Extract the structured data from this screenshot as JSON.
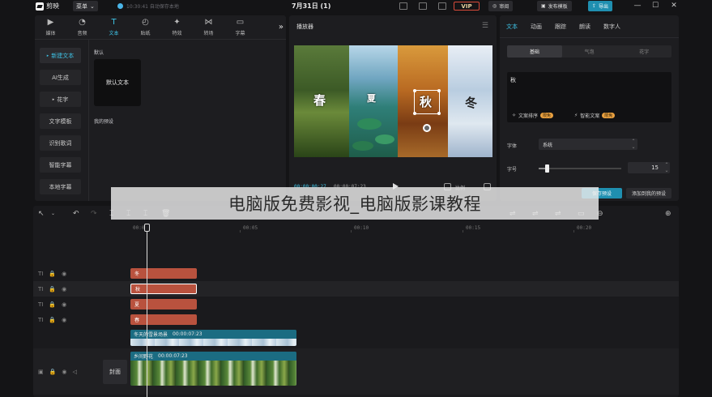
{
  "titlebar": {
    "app_name": "剪映",
    "menu_label": "菜单",
    "autosave": "10:30:41 自动保存本地",
    "project_title": "7月31日 (1)",
    "vip_label": "VIP",
    "review_label": "审阅",
    "publish_template_label": "发布模板",
    "export_label": "导出"
  },
  "tools": {
    "tabs": [
      {
        "label": "媒体",
        "icon": "media-icon"
      },
      {
        "label": "音频",
        "icon": "audio-icon"
      },
      {
        "label": "文本",
        "icon": "text-icon"
      },
      {
        "label": "贴纸",
        "icon": "sticker-icon"
      },
      {
        "label": "特效",
        "icon": "effects-icon"
      },
      {
        "label": "转场",
        "icon": "transition-icon"
      },
      {
        "label": "字幕",
        "icon": "caption-icon"
      }
    ],
    "active_tab": "文本"
  },
  "text_panel": {
    "side_items": [
      "新建文本",
      "AI生成",
      "花字",
      "文字模板",
      "识别歌词",
      "智能字幕",
      "本地字幕"
    ],
    "default_section": "默认",
    "default_card": "默认文本",
    "presets_section": "我的预设"
  },
  "player": {
    "title": "播放器",
    "current_time": "00:00:00:27",
    "duration": "00:00:07:23",
    "ratio_label": "比例",
    "overlay_chars": [
      "春",
      "夏",
      "秋",
      "冬"
    ]
  },
  "inspector": {
    "tabs": [
      "文本",
      "动画",
      "跟踪",
      "朗读",
      "数字人"
    ],
    "active_tab": "文本",
    "sub_tabs": [
      "基础",
      "气泡",
      "花字"
    ],
    "active_sub_tab": "基础",
    "text_value": "秋",
    "feature_1": "文案排序",
    "feature_2": "智能文案",
    "feature_badge": "限免",
    "font_label": "字体",
    "font_value": "系统",
    "size_label": "字号",
    "size_value": "15",
    "size_fraction": 0.1,
    "save_preset_label": "保存预设",
    "add_preset_label": "添加到我的预设"
  },
  "timeline": {
    "ruler_labels": [
      "00:00",
      "00:05",
      "00:10",
      "00:15",
      "00:20"
    ],
    "text_clips": [
      "冬",
      "秋",
      "夏",
      "春"
    ],
    "video_track_1": {
      "name": "冬天的雪景场景",
      "duration": "00:00:07:23"
    },
    "video_track_2": {
      "name": "乡间野花",
      "duration": "00:00:07:23"
    },
    "cover_label": "封面"
  },
  "watermark": "电脑版免费影视_电脑版影课教程"
}
